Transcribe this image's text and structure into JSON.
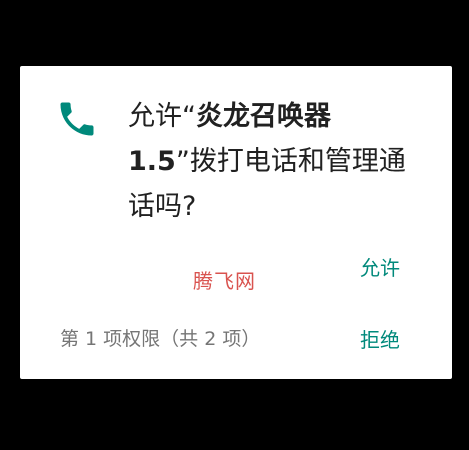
{
  "dialog": {
    "icon": "phone-icon",
    "accent_color": "#00897b",
    "message_prefix": "允许“",
    "app_name": "炎龙召唤器 1.5",
    "message_suffix": "”拨打电话和管理通话吗?",
    "watermark": "腾飞网",
    "allow_label": "允许",
    "deny_label": "拒绝",
    "counter": "第 1 项权限（共 2 项）"
  }
}
